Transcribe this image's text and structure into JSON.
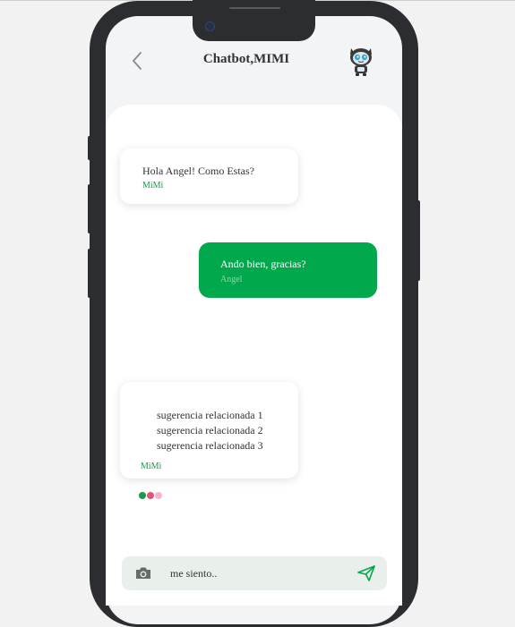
{
  "header": {
    "title": "Chatbot,MIMI"
  },
  "messages": [
    {
      "type": "bot",
      "text": "Hola Angel! Como Estas?",
      "sender": "MiMi"
    },
    {
      "type": "user",
      "text": "Ando bien, gracias?",
      "sender": "Angel"
    },
    {
      "type": "bot-suggestions",
      "suggestions": [
        "sugerencia relacionada 1",
        "sugerencia relacionada 2",
        "sugerencia relacionada 3"
      ],
      "sender": "MiMi"
    }
  ],
  "input": {
    "placeholder": "me siento.."
  },
  "icons": {
    "back": "chevron-left-icon",
    "avatar": "robot-mascot-icon",
    "camera": "camera-icon",
    "send": "paper-plane-icon"
  },
  "colors": {
    "accent_green": "#01a84c",
    "sender_bot": "#1a9a4a",
    "sender_user": "#7ee0a6",
    "typing_dots": [
      "#1a9a4a",
      "#e0557a",
      "#f5b6c9"
    ],
    "input_bg": "#e9f0ec"
  }
}
